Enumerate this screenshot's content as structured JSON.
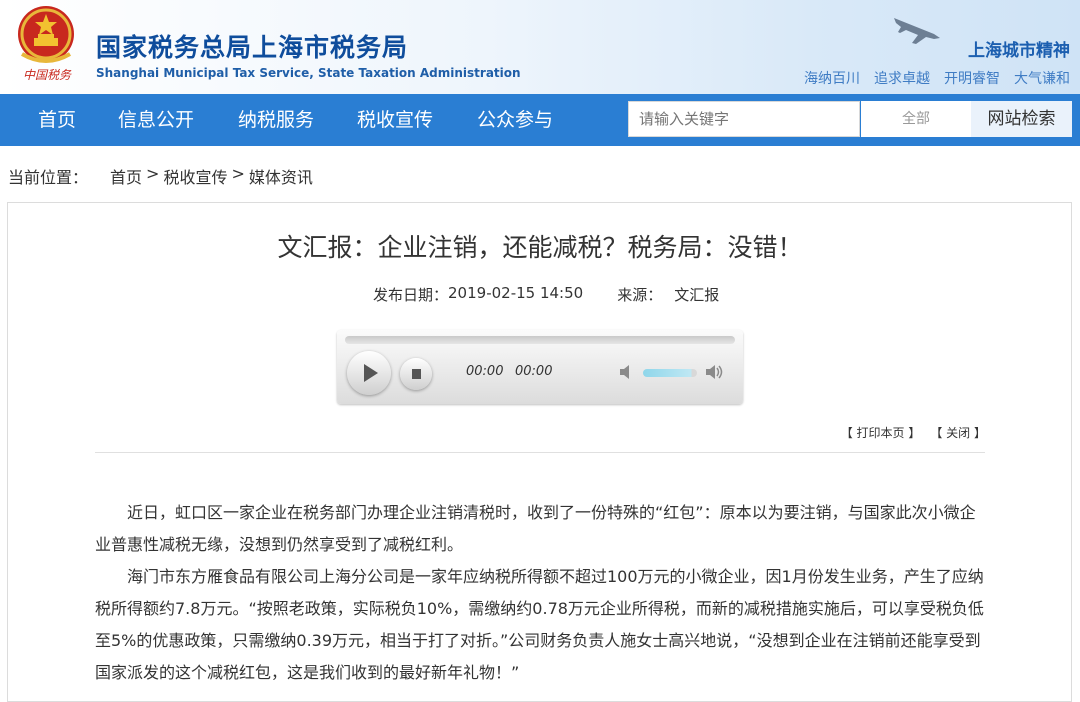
{
  "header": {
    "title": "国家税务总局上海市税务局",
    "subtitle": "Shanghai Municipal Tax Service, State Taxation Administration",
    "emblem_caption": "中国税务",
    "city_spirit": "上海城市精神",
    "mottos": [
      "海纳百川",
      "追求卓越",
      "开明睿智",
      "大气谦和"
    ]
  },
  "nav": {
    "items": [
      "首页",
      "信息公开",
      "纳税服务",
      "税收宣传",
      "公众参与"
    ],
    "search_placeholder": "请输入关键字",
    "scope": "全部",
    "search_button": "网站检索"
  },
  "breadcrumb": {
    "label": "当前位置：",
    "items": [
      "首页",
      "税收宣传",
      "媒体资讯"
    ],
    "separator": ">"
  },
  "article": {
    "title": "文汇报：企业注销，还能减税？税务局：没错！",
    "date_label": "发布日期：",
    "date": "2019-02-15 14:50",
    "source_label": "来源：",
    "source": "文汇报",
    "print_label": "【 打印本页 】",
    "close_label": "【 关闭 】",
    "paragraphs": [
      "近日，虹口区一家企业在税务部门办理企业注销清税时，收到了一份特殊的“红包”：原本以为要注销，与国家此次小微企业普惠性减税无缘，没想到仍然享受到了减税红利。",
      "海门市东方雁食品有限公司上海分公司是一家年应纳税所得额不超过100万元的小微企业，因1月份发生业务，产生了应纳税所得额约7.8万元。“按照老政策，实际税负10%，需缴纳约0.78万元企业所得税，而新的减税措施实施后，可以享受税负低至5%的优惠政策，只需缴纳0.39万元，相当于打了对折。”公司财务负责人施女士高兴地说，“没想到企业在注销前还能享受到国家派发的这个减税红包，这是我们收到的最好新年礼物！”"
    ]
  },
  "player": {
    "current_time": "00:00",
    "duration": "00:00",
    "volume_level": 0.9
  },
  "colors": {
    "nav_bg": "#2a7ed3",
    "title_blue": "#0f4d9c",
    "emblem_red": "#c8281e"
  }
}
